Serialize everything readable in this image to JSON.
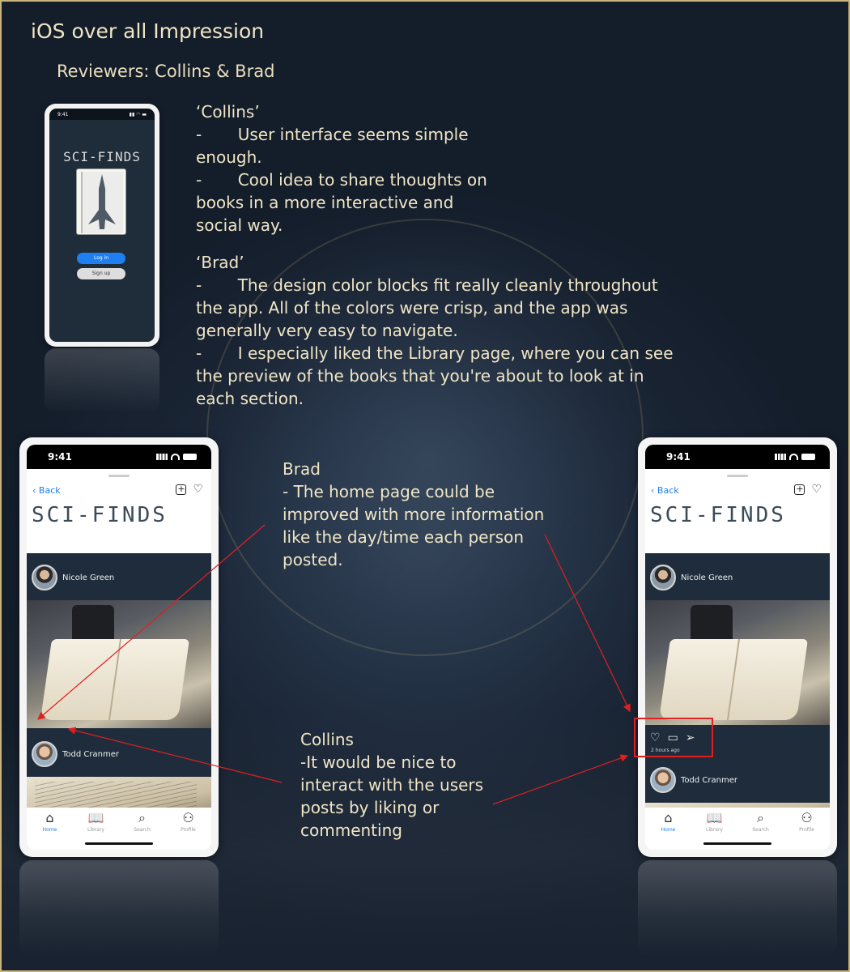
{
  "slide": {
    "title": "iOS over all Impression",
    "reviewers": "Reviewers: Collins & Brad"
  },
  "feedback": {
    "collins": {
      "name": "‘Collins’",
      "points": [
        "-       User interface seems simple\nenough.",
        "-       Cool idea to share thoughts on\nbooks in a more interactive and\nsocial way."
      ]
    },
    "brad": {
      "name": "‘Brad’",
      "points": [
        "-       The design color blocks fit really cleanly throughout\nthe app. All of the colors were crisp, and the app was\ngenerally very easy to navigate.",
        "-       I especially liked the Library page, where you can see\nthe preview of the books that you're about to look at in\neach section."
      ]
    }
  },
  "callouts": {
    "brad": "Brad\n- The home page could be\nimproved with more information\nlike the day/time each person\nposted.",
    "collins": "Collins\n-It would be nice to\ninteract with the users\nposts by liking or\ncommenting"
  },
  "login_phone": {
    "time": "9:41",
    "logo": "SCI-FINDS",
    "login_button": "Log in",
    "signup_button": "Sign up"
  },
  "phone": {
    "time": "9:41",
    "back": "Back",
    "brand": "SCI-FINDS",
    "posts": [
      {
        "user": "Nicole Green"
      },
      {
        "user": "Todd Cranmer"
      }
    ],
    "time_ago": "2 hours ago",
    "tabs": [
      "Home",
      "Library",
      "Search",
      "Profile"
    ]
  },
  "colors": {
    "highlight": "#e02020",
    "accent": "#1d7ff2",
    "feed_bg": "#1e2c3b"
  },
  "icons": [
    "back-chevron-icon",
    "add-square-icon",
    "heart-icon",
    "comment-icon",
    "send-icon",
    "home-icon",
    "book-icon",
    "search-icon",
    "people-icon"
  ]
}
